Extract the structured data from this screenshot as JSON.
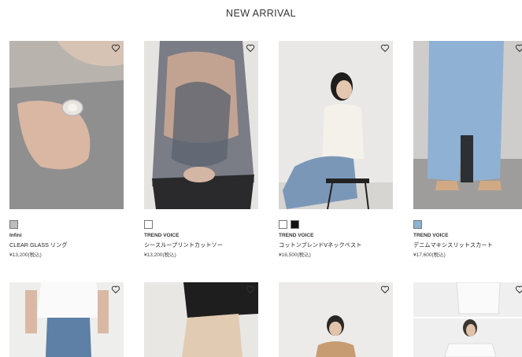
{
  "section_title": "NEW ARRIVAL",
  "products": [
    {
      "brand": "Infini",
      "name": "CLEAR GLASS リング",
      "price": "¥13,200(税込)",
      "swatches": [
        "#bdbdbd"
      ],
      "image": "ring-on-hand-photo"
    },
    {
      "brand": "TREND VOICE",
      "name": "シースループリントカットソー",
      "price": "¥13,200(税込)",
      "swatches": [
        "#ffffff"
      ],
      "image": "sheer-printed-top-photo"
    },
    {
      "brand": "TREND VOICE",
      "name": "コットンブレンドVネックベスト",
      "price": "¥16,500(税込)",
      "swatches": [
        "#ffffff",
        "#111111"
      ],
      "image": "white-vest-model-photo"
    },
    {
      "brand": "TREND VOICE",
      "name": "デニムマキシスリットスカート",
      "price": "¥17,600(税込)",
      "swatches": [
        "#8fb2d6"
      ],
      "image": "denim-maxi-skirt-photo"
    }
  ],
  "products_row2": [
    {
      "image": "white-tee-jeans-photo"
    },
    {
      "image": "black-top-beige-skirt-photo"
    },
    {
      "image": "beige-knit-model-photo"
    },
    {
      "image": "white-shirt-model-photo"
    }
  ],
  "colors": {
    "heart": "#333333",
    "text": "#222222"
  },
  "icons": {
    "favorite": "heart-icon"
  }
}
